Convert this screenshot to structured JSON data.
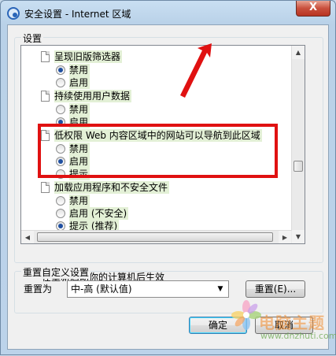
{
  "window": {
    "title": "安全设置 - Internet 区域",
    "close_label": "X"
  },
  "settings_group": {
    "label": "设置",
    "items": [
      {
        "label": "呈现旧版筛选器",
        "options": [
          {
            "label": "禁用",
            "checked": true
          },
          {
            "label": "启用",
            "checked": false
          }
        ]
      },
      {
        "label": "持续使用用户数据",
        "options": [
          {
            "label": "禁用",
            "checked": false
          },
          {
            "label": "启用",
            "checked": true
          }
        ]
      },
      {
        "label": "低权限 Web 内容区域中的网站可以导航到此区域",
        "options": [
          {
            "label": "禁用",
            "checked": false
          },
          {
            "label": "启用",
            "checked": true
          },
          {
            "label": "提示",
            "checked": false
          }
        ]
      },
      {
        "label": "加载应用程序和不安全文件",
        "options": [
          {
            "label": "禁用",
            "checked": false
          },
          {
            "label": "启用 (不安全)",
            "checked": false
          },
          {
            "label": "提示 (推荐)",
            "checked": true
          }
        ]
      }
    ],
    "restart_note": "*在重新启动你的计算机后生效"
  },
  "reset_group": {
    "label": "重置自定义设置",
    "reset_to_label": "重置为",
    "selected_level": "中-高 (默认值)",
    "reset_button": "重置(E)..."
  },
  "footer": {
    "ok": "确定",
    "cancel": "取消"
  },
  "watermark": {
    "text": "电脑主题",
    "url": "www.dnzhuti.com"
  },
  "colors": {
    "highlight_box": "#e01111",
    "label_bg": "#e3f0d6"
  }
}
